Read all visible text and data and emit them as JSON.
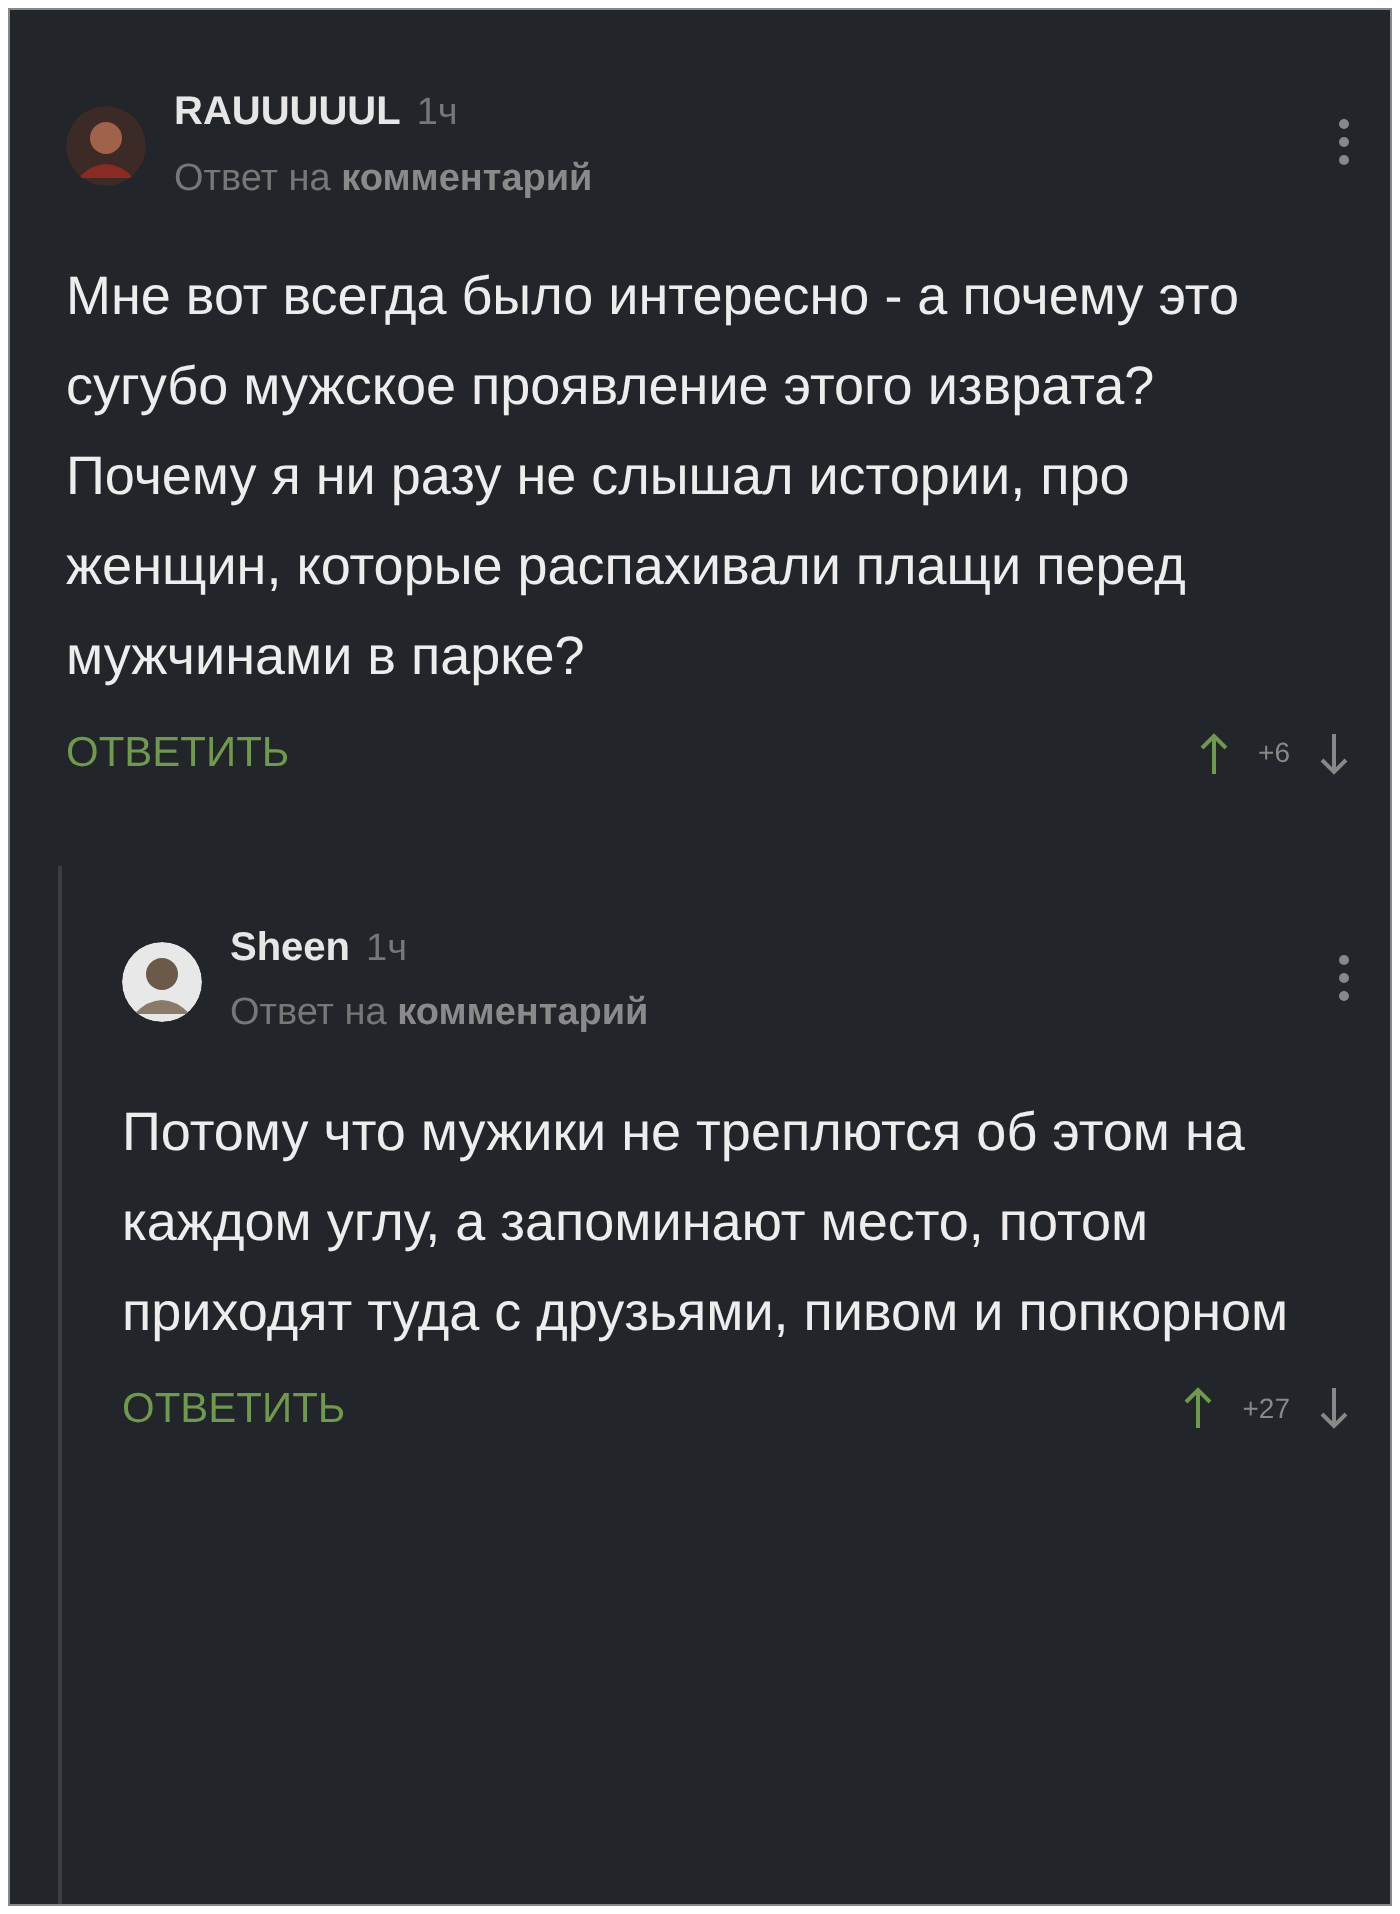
{
  "comments": [
    {
      "author": "RAUUUUUL",
      "time": "1ч",
      "reply_to_prefix": "Ответ на",
      "reply_to_link": "комментарий",
      "body": "Мне вот всегда было интересно - а почему это сугубо мужское проявление этого изврата? Почему я ни разу не слышал истории, про женщин, которые распахивали плащи перед мужчинами в парке?",
      "reply_button": "ОТВЕТИТЬ",
      "rating": "+6",
      "upvoted": true,
      "children": [
        {
          "author": "Sheen",
          "time": "1ч",
          "reply_to_prefix": "Ответ на",
          "reply_to_link": "комментарий",
          "body": "Потому что мужики не треплются об этом на каждом углу, а запоминают место, потом приходят туда с друзьями, пивом и попкорном",
          "reply_button": "ОТВЕТИТЬ",
          "rating": "+27",
          "upvoted": true
        }
      ]
    }
  ]
}
